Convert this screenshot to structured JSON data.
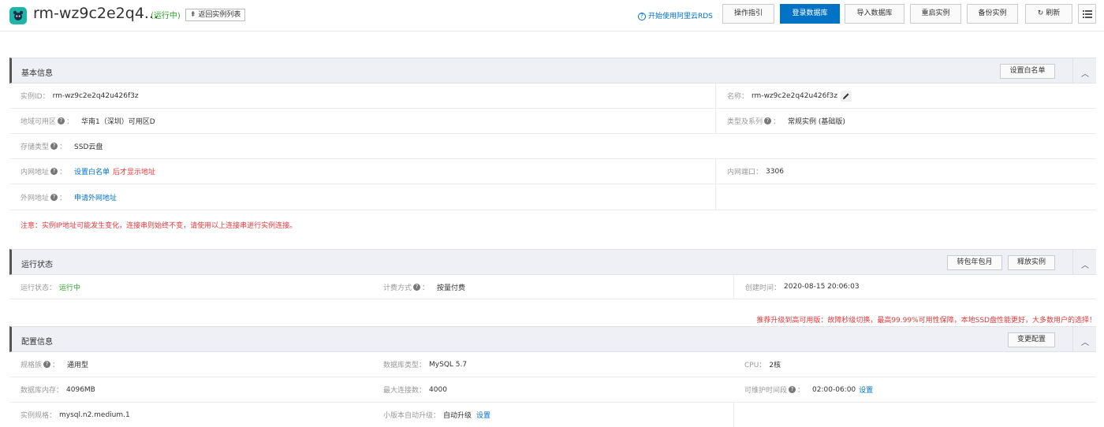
{
  "header": {
    "title": "rm-wz9c2e2q4...",
    "status": "(运行中)",
    "back_label": "返回实例列表",
    "back_arrow": "⇞",
    "help_label": "开始使用阿里云RDS",
    "buttons": {
      "guide": "操作指引",
      "login": "登录数据库",
      "import": "导入数据库",
      "restart": "重启实例",
      "backup": "备份实例",
      "refresh": "刷新"
    }
  },
  "basic": {
    "title": "基本信息",
    "whitelist_button": "设置白名单",
    "instance_id_label": "实例ID：",
    "instance_id": "rm-wz9c2e2q42u426f3z",
    "name_label": "名称：",
    "name": "rm-wz9c2e2q42u426f3z",
    "region_label": "地域可用区",
    "region": "华南1（深圳）可用区D",
    "type_label": "类型及系列",
    "type": "常规实例 (基础版)",
    "storage_label": "存储类型",
    "storage": "SSD云盘",
    "intranet_label": "内网地址",
    "intranet_link": "设置白名单",
    "intranet_suffix": "后才显示地址",
    "intranet_port_label": "内网端口：",
    "intranet_port": "3306",
    "internet_label": "外网地址",
    "internet_link": "申请外网地址",
    "note": "注意：实例IP地址可能发生变化，连接串则始终不变，请使用以上连接串进行实例连接。"
  },
  "running": {
    "title": "运行状态",
    "convert_button": "转包年包月",
    "release_button": "释放实例",
    "status_label": "运行状态：",
    "status": "运行中",
    "billing_label": "计费方式",
    "billing": "按量付费",
    "created_label": "创建时间：",
    "created": "2020-08-15 20:06:03"
  },
  "promo": "推荐升级到高可用版：故障秒级切换，最高99.99%可用性保障，本地SSD盘性能更好，大多数用户的选择！",
  "config": {
    "title": "配置信息",
    "change_button": "变更配置",
    "family_label": "规格族",
    "family": "通用型",
    "db_type_label": "数据库类型：",
    "db_type": "MySQL 5.7",
    "cpu_label": "CPU：",
    "cpu": "2核",
    "memory_label": "数据库内存：",
    "memory": "4096MB",
    "max_conn_label": "最大连接数：",
    "max_conn": "4000",
    "maint_label": "可维护时间段",
    "maint": "02:00-06:00",
    "maint_link": "设置",
    "spec_label": "实例规格：",
    "spec": "mysql.n2.medium.1",
    "minor_label": "小版本自动升级：",
    "minor": "自动升级",
    "minor_link": "设置"
  }
}
